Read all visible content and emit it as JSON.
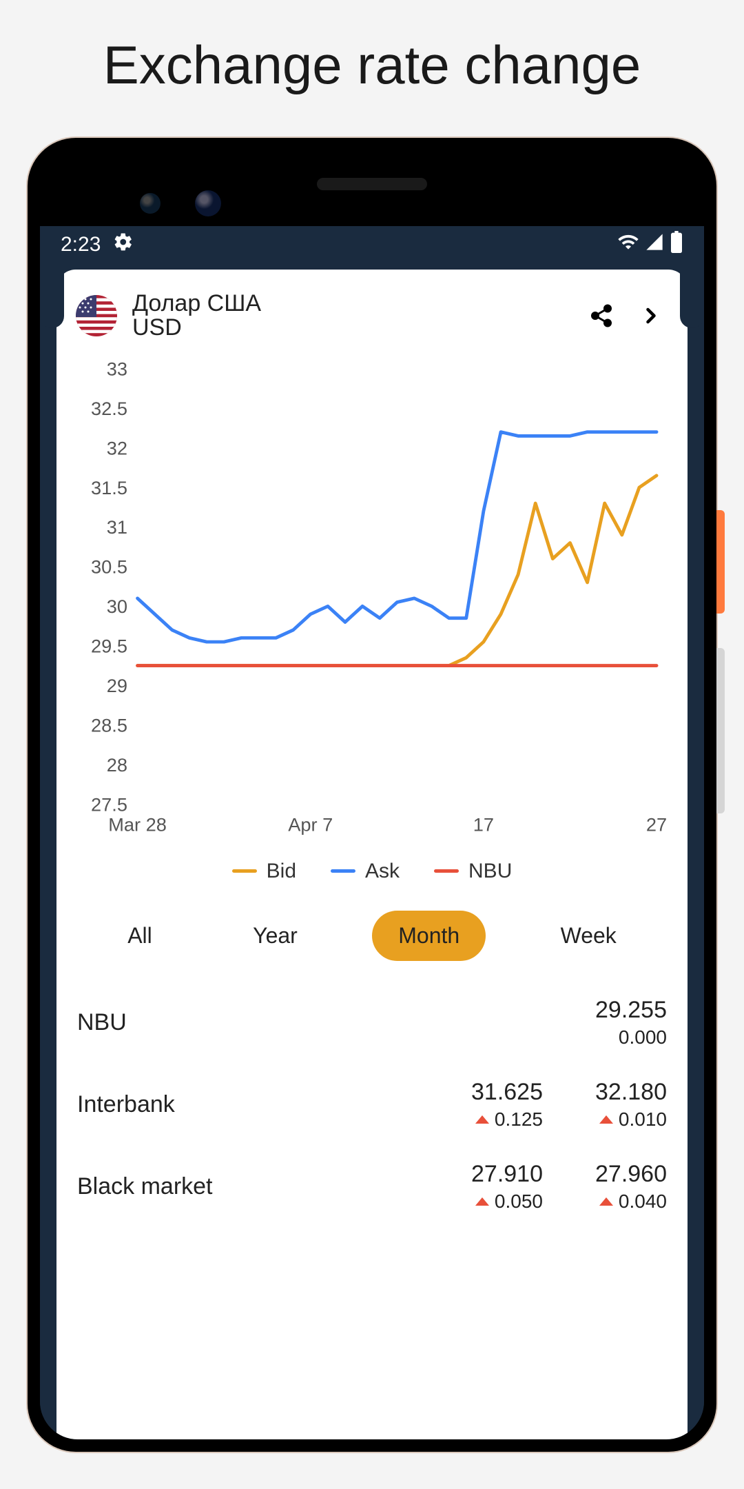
{
  "page_title": "Exchange rate change",
  "status": {
    "time": "2:23"
  },
  "currency": {
    "name": "Долар США",
    "code": "USD"
  },
  "legend": {
    "bid": {
      "label": "Bid",
      "color": "#e8a020"
    },
    "ask": {
      "label": "Ask",
      "color": "#3b82f6"
    },
    "nbu": {
      "label": "NBU",
      "color": "#e8503a"
    }
  },
  "tabs": {
    "all": "All",
    "year": "Year",
    "month": "Month",
    "week": "Week",
    "active": "month"
  },
  "rates": {
    "nbu": {
      "name": "NBU",
      "col2": {
        "value": "29.255",
        "change": "0.000",
        "dir": "none"
      }
    },
    "interbank": {
      "name": "Interbank",
      "col1": {
        "value": "31.625",
        "change": "0.125",
        "dir": "up"
      },
      "col2": {
        "value": "32.180",
        "change": "0.010",
        "dir": "up"
      }
    },
    "black": {
      "name": "Black market",
      "col1": {
        "value": "27.910",
        "change": "0.050",
        "dir": "up"
      },
      "col2": {
        "value": "27.960",
        "change": "0.040",
        "dir": "up"
      }
    }
  },
  "chart_data": {
    "type": "line",
    "xlabel": "",
    "ylabel": "",
    "ylim": [
      27.5,
      33
    ],
    "y_ticks": [
      27.5,
      28,
      28.5,
      29,
      29.5,
      30,
      30.5,
      31,
      31.5,
      32,
      32.5,
      33
    ],
    "x_ticks": [
      "Mar 28",
      "Apr 7",
      "17",
      "27"
    ],
    "x": [
      0,
      1,
      2,
      3,
      4,
      5,
      6,
      7,
      8,
      9,
      10,
      11,
      12,
      13,
      14,
      15,
      16,
      17,
      18,
      19,
      20,
      21,
      22,
      23,
      24,
      25,
      26,
      27,
      28,
      29,
      30
    ],
    "series": [
      {
        "name": "Ask",
        "color": "#3b82f6",
        "values": [
          30.1,
          29.9,
          29.7,
          29.6,
          29.55,
          29.55,
          29.6,
          29.6,
          29.6,
          29.7,
          29.9,
          30.0,
          29.8,
          30.0,
          29.85,
          30.05,
          30.1,
          30.0,
          29.85,
          29.85,
          31.2,
          32.2,
          32.15,
          32.15,
          32.15,
          32.15,
          32.2,
          32.2,
          32.2,
          32.2,
          32.2
        ]
      },
      {
        "name": "Bid",
        "color": "#e8a020",
        "values": [
          29.25,
          29.25,
          29.25,
          29.25,
          29.25,
          29.25,
          29.25,
          29.25,
          29.25,
          29.25,
          29.25,
          29.25,
          29.25,
          29.25,
          29.25,
          29.25,
          29.25,
          29.25,
          29.25,
          29.35,
          29.55,
          29.9,
          30.4,
          31.3,
          30.6,
          30.8,
          30.3,
          31.3,
          30.9,
          31.5,
          31.65
        ]
      },
      {
        "name": "NBU",
        "color": "#e8503a",
        "values": [
          29.25,
          29.25,
          29.25,
          29.25,
          29.25,
          29.25,
          29.25,
          29.25,
          29.25,
          29.25,
          29.25,
          29.25,
          29.25,
          29.25,
          29.25,
          29.25,
          29.25,
          29.25,
          29.25,
          29.25,
          29.25,
          29.25,
          29.25,
          29.25,
          29.25,
          29.25,
          29.25,
          29.25,
          29.25,
          29.25,
          29.25
        ]
      }
    ]
  }
}
